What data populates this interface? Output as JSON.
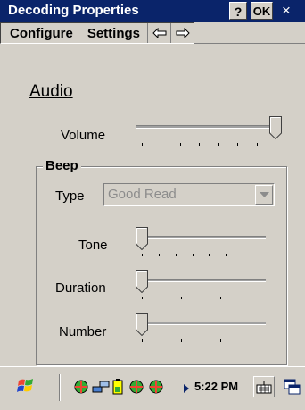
{
  "window": {
    "title": "Decoding Properties",
    "help_label": "?",
    "ok_label": "OK",
    "close_label": "×"
  },
  "menu": {
    "items": [
      "Configure",
      "Settings"
    ],
    "prev_icon": "left-arrow-icon",
    "next_icon": "right-arrow-icon"
  },
  "audio": {
    "section_title": "Audio",
    "volume_label": "Volume",
    "volume_level": 1.0
  },
  "beep": {
    "group_title": "Beep",
    "type_label": "Type",
    "type_value": "Good Read",
    "tone_label": "Tone",
    "tone_level": 0.0,
    "duration_label": "Duration",
    "duration_level": 0.0,
    "number_label": "Number",
    "number_level": 0.0
  },
  "taskbar": {
    "time": "5:22 PM",
    "start_icon": "windows-flag-icon",
    "tray_icons": [
      "network-ball-icon",
      "connection-icon",
      "battery-icon",
      "network-ball-icon",
      "network-ball-icon"
    ],
    "keyboard_icon": "keyboard-icon",
    "window_icon": "window-switch-icon"
  },
  "colors": {
    "title_bar": "#0a246a",
    "face": "#d4d0c8",
    "disabled_text": "#8c8c8c"
  }
}
